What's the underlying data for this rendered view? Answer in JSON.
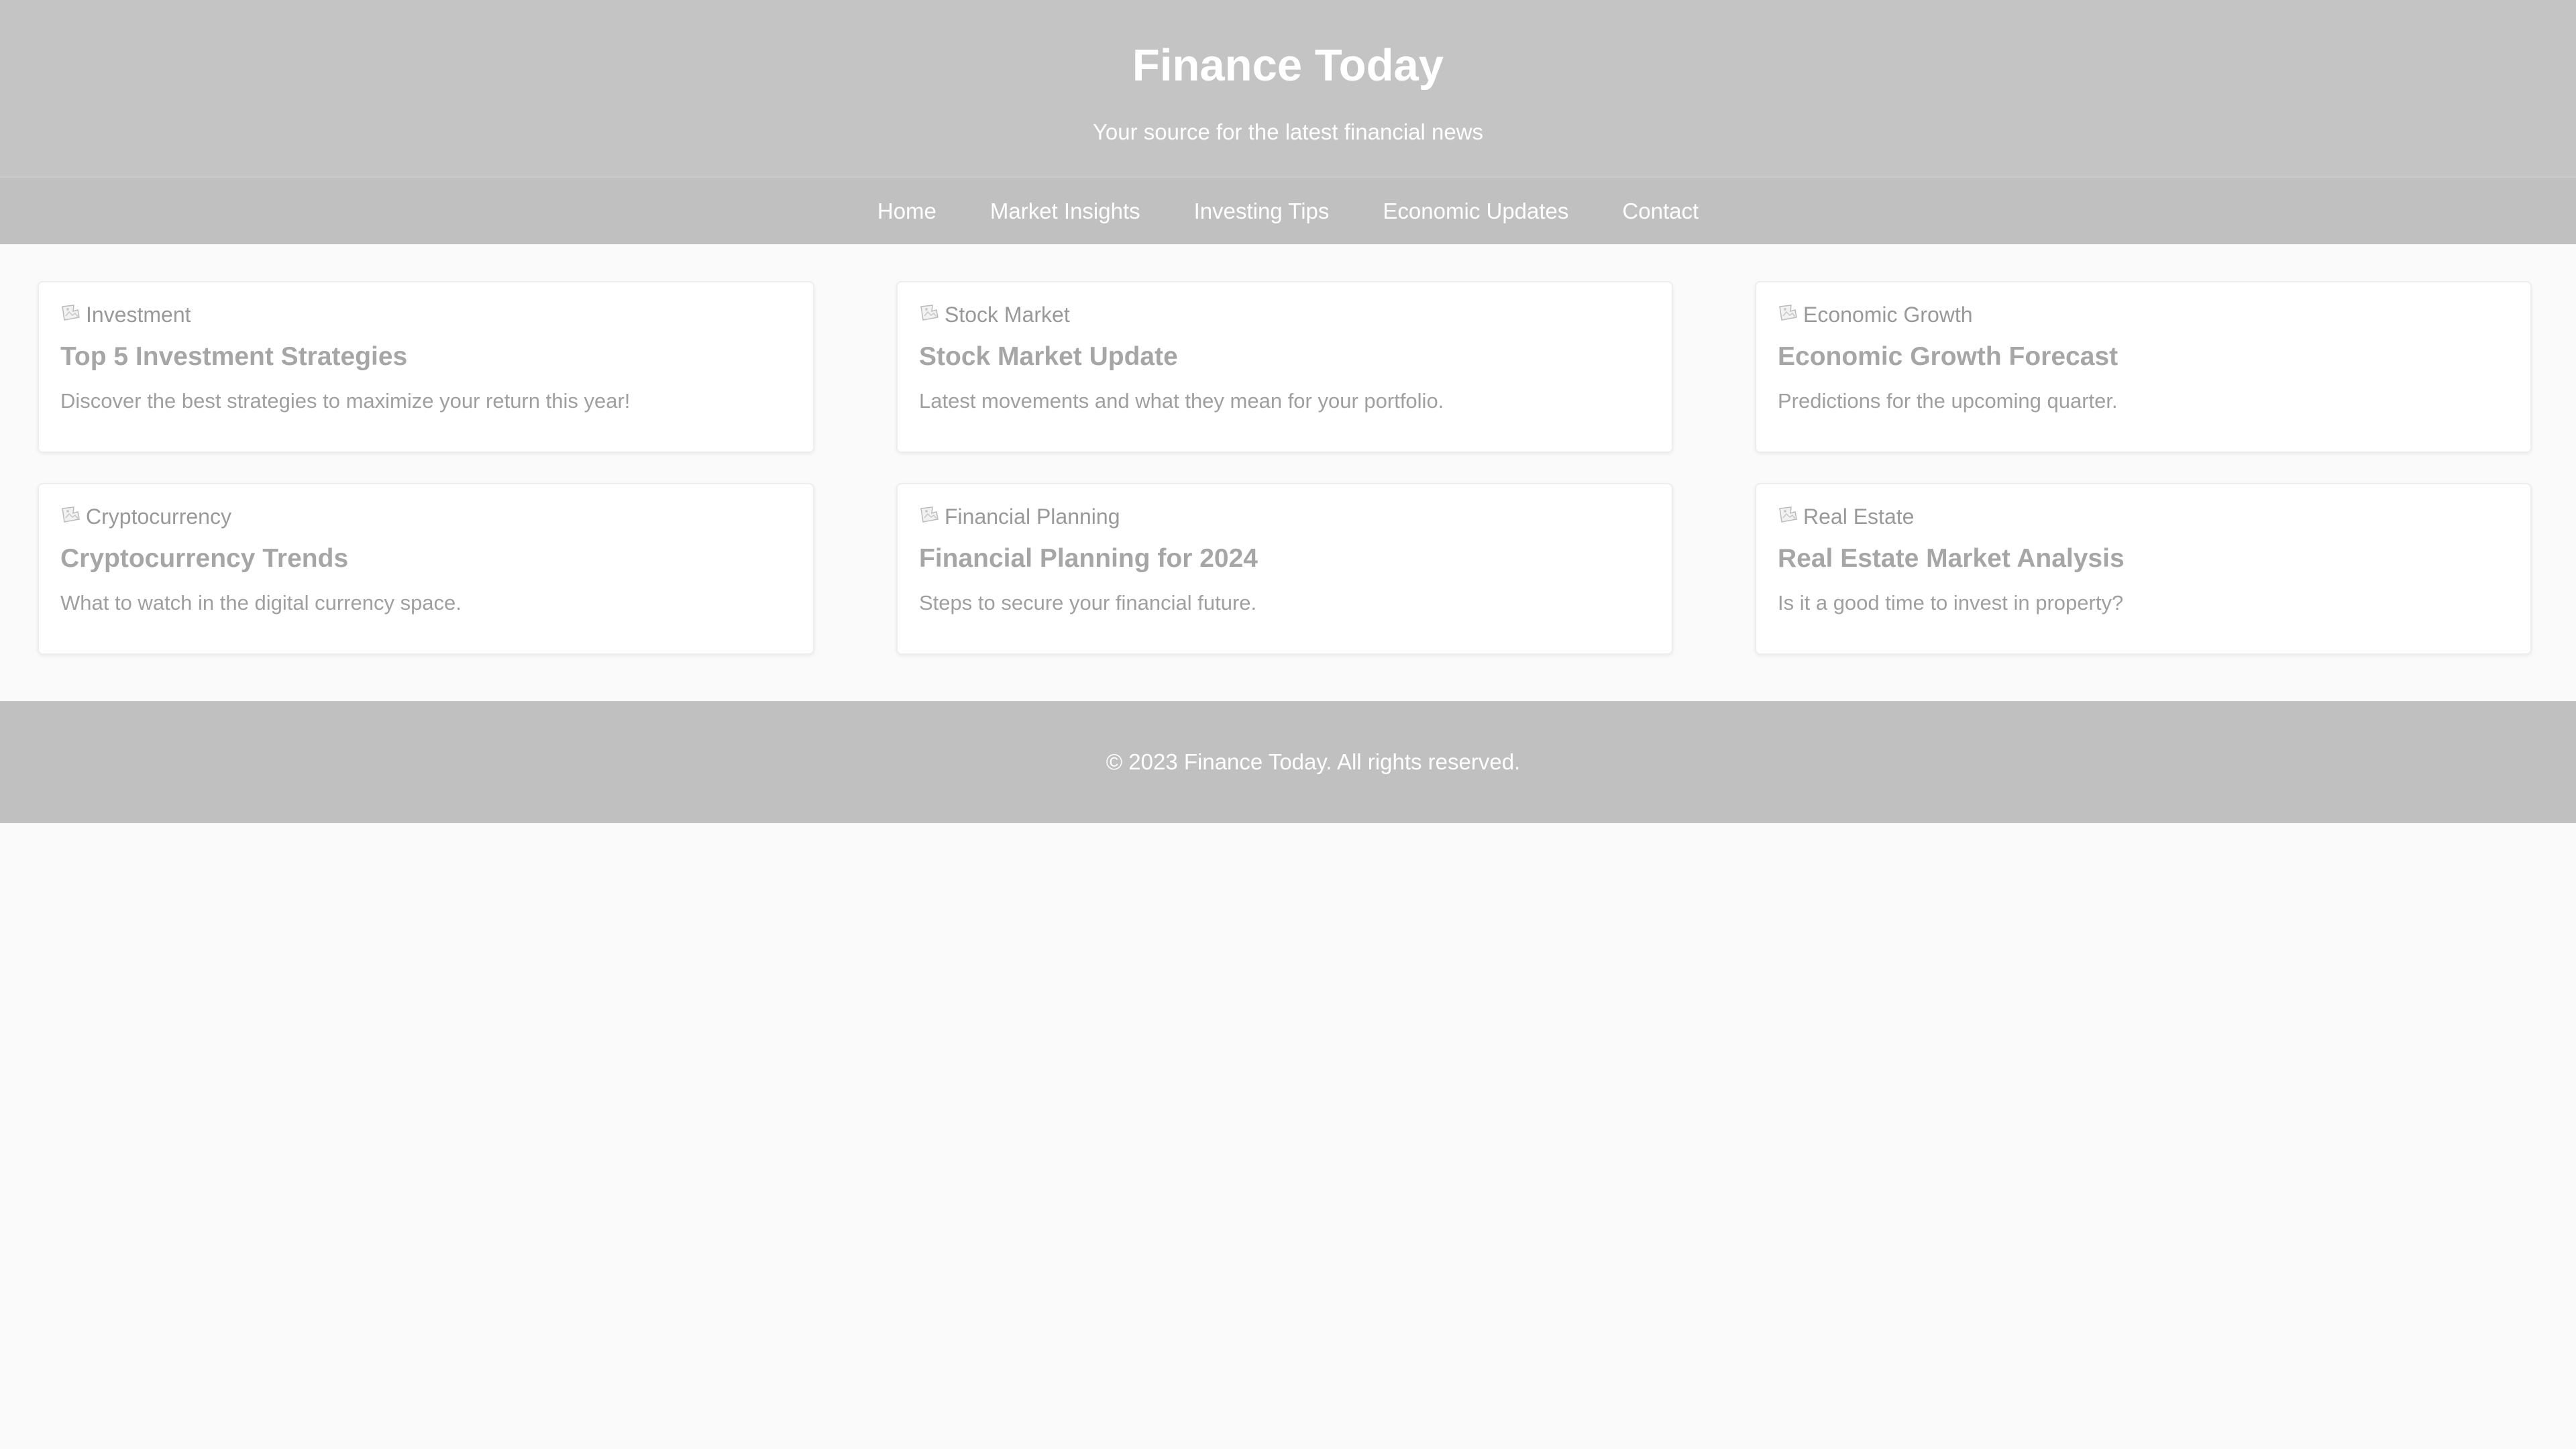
{
  "header": {
    "title": "Finance Today",
    "subtitle": "Your source for the latest financial news"
  },
  "nav": {
    "items": [
      {
        "label": "Home"
      },
      {
        "label": "Market Insights"
      },
      {
        "label": "Investing Tips"
      },
      {
        "label": "Economic Updates"
      },
      {
        "label": "Contact"
      }
    ]
  },
  "articles": [
    {
      "image_alt": "Investment",
      "title": "Top 5 Investment Strategies",
      "description": "Discover the best strategies to maximize your return this year!"
    },
    {
      "image_alt": "Stock Market",
      "title": "Stock Market Update",
      "description": "Latest movements and what they mean for your portfolio."
    },
    {
      "image_alt": "Economic Growth",
      "title": "Economic Growth Forecast",
      "description": "Predictions for the upcoming quarter."
    },
    {
      "image_alt": "Cryptocurrency",
      "title": "Cryptocurrency Trends",
      "description": "What to watch in the digital currency space."
    },
    {
      "image_alt": "Financial Planning",
      "title": "Financial Planning for 2024",
      "description": "Steps to secure your financial future."
    },
    {
      "image_alt": "Real Estate",
      "title": "Real Estate Market Analysis",
      "description": "Is it a good time to invest in property?"
    }
  ],
  "footer": {
    "text": "© 2023 Finance Today. All rights reserved."
  },
  "colors": {
    "header_bg": "#c4c4c4",
    "nav_bg": "#c0c0c0",
    "footer_bg": "#c0c0c0",
    "page_bg": "#fafafa",
    "card_bg": "#ffffff"
  }
}
